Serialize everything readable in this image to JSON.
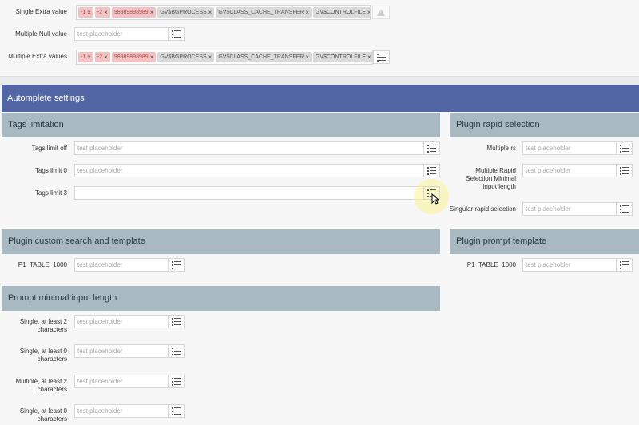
{
  "top": {
    "single_extra_label": "Single Extra value",
    "multiple_null_label": "Multiple Null value",
    "multiple_extra_label": "Multiple Extra values",
    "placeholder": "test placeholder",
    "tags": [
      "-1",
      "-2",
      "98989898989",
      "GV$BGPROCESS",
      "GV$CLASS_CACHE_TRANSFER",
      "GV$CONTROLFILE"
    ],
    "tags_error_count": 3
  },
  "main": {
    "title": "Automplete settings",
    "tags_limitation": {
      "title": "Tags limitation",
      "rows": [
        {
          "label": "Tags limit off",
          "placeholder": "test placeholder"
        },
        {
          "label": "Tags limit 0",
          "placeholder": "test placeholder"
        },
        {
          "label": "Tags limit 3",
          "placeholder": ""
        }
      ]
    },
    "plugin_rapid": {
      "title": "Plugin rapid selection",
      "rows": [
        {
          "label": "Multiple rs",
          "placeholder": "test placeholder"
        },
        {
          "label": "Multiple Rapid Selection Minimal input length",
          "placeholder": "test placeholder"
        },
        {
          "label": "Singular rapid selection",
          "placeholder": "test placeholder"
        }
      ]
    },
    "custom_search": {
      "title": "Plugin custom search and template",
      "rows": [
        {
          "label": "P1_TABLE_1000",
          "placeholder": "test placeholder"
        }
      ]
    },
    "prompt_template": {
      "title": "Plugin prompt template",
      "rows": [
        {
          "label": "P1_TABLE_1000",
          "placeholder": "test placeholder"
        }
      ]
    },
    "prompt_min": {
      "title": "Prompt minimal input length",
      "rows": [
        {
          "label": "Single, at least 2 characters",
          "placeholder": "test placeholder"
        },
        {
          "label": "Single, at least 0 characters",
          "placeholder": "test placeholder"
        },
        {
          "label": "Multiple, at least 2 characters",
          "placeholder": "test placeholder"
        },
        {
          "label": "Single, at least 0 characters",
          "placeholder": "test placeholder"
        }
      ]
    }
  }
}
